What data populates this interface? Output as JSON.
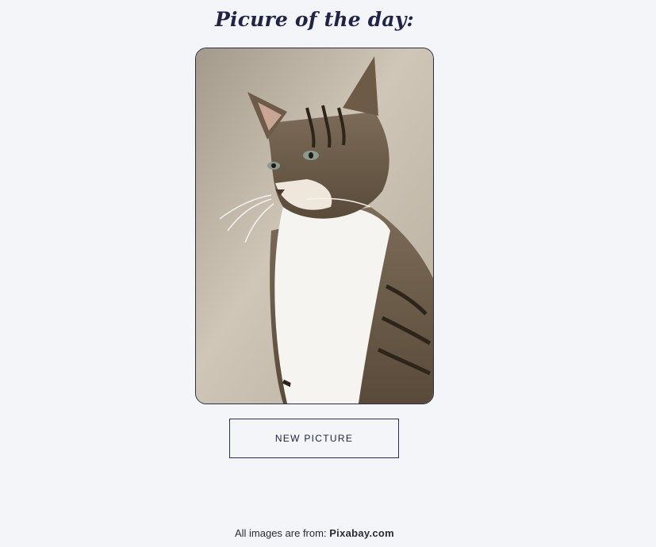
{
  "header": {
    "title": "Picure of the day:"
  },
  "photo": {
    "subject_icon": "cat-photo",
    "background_color": "#bcb3a5"
  },
  "actions": {
    "new_picture_label": "NEW PICTURE"
  },
  "footer": {
    "prefix": "All images are from:",
    "source": "Pixabay.com"
  }
}
